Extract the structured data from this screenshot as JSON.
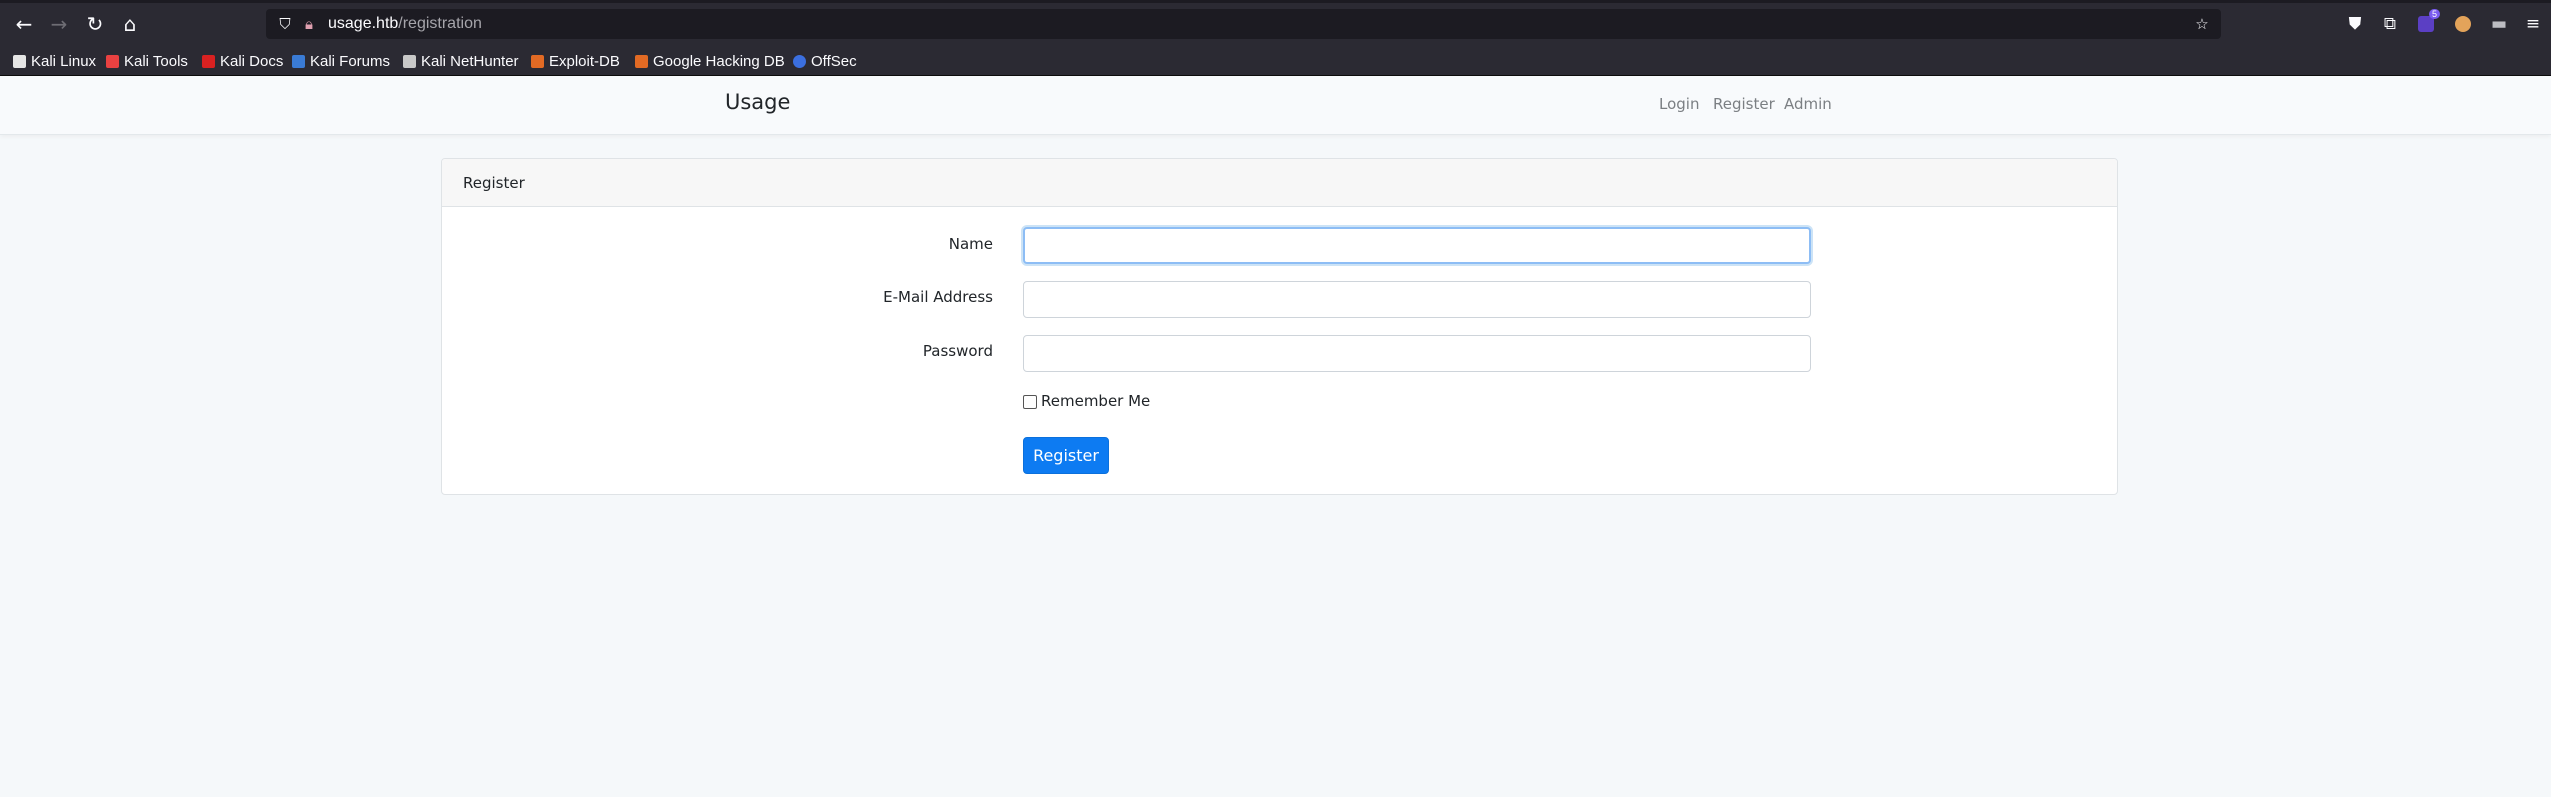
{
  "browser": {
    "url_host": "usage.htb",
    "url_path": "/registration",
    "icons": {
      "back": "back-arrow-icon",
      "forward": "forward-arrow-icon",
      "reload": "reload-icon",
      "home": "home-icon",
      "shield": "shield-icon",
      "lock": "lock-icon",
      "bookmark_star": "star-icon",
      "pocket": "pocket-icon",
      "extensions": "extensions-icon",
      "menu": "hamburger-menu-icon"
    },
    "extension_badge": "5",
    "bookmarks": [
      {
        "label": "Kali Linux",
        "color": "#e5e5e5"
      },
      {
        "label": "Kali Tools",
        "color": "#e94141"
      },
      {
        "label": "Kali Docs",
        "color": "#d92121"
      },
      {
        "label": "Kali Forums",
        "color": "#3a7bd5"
      },
      {
        "label": "Kali NetHunter",
        "color": "#c8c8c8"
      },
      {
        "label": "Exploit-DB",
        "color": "#e26a24"
      },
      {
        "label": "Google Hacking DB",
        "color": "#e26a24"
      },
      {
        "label": "OffSec",
        "color": "#3b6fe0"
      }
    ]
  },
  "navbar": {
    "brand": "Usage",
    "links": [
      "Login",
      "Register",
      "Admin"
    ]
  },
  "card": {
    "title": "Register",
    "fields": [
      {
        "label": "Name",
        "value": ""
      },
      {
        "label": "E-Mail Address",
        "value": ""
      },
      {
        "label": "Password",
        "value": ""
      }
    ],
    "remember_label": "Remember Me",
    "remember_checked": false,
    "submit_label": "Register"
  },
  "colors": {
    "accent": "#0d7bf2",
    "chrome_bg": "#2b2a33",
    "page_bg": "#f5f8fa"
  }
}
